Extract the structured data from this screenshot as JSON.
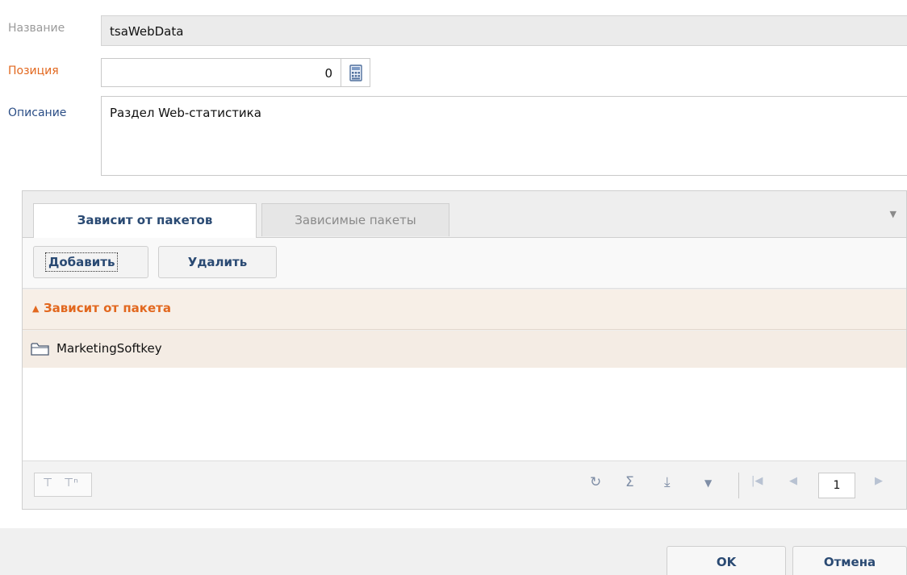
{
  "form": {
    "name_label": "Название",
    "name_value": "tsaWebData",
    "position_label": "Позиция",
    "position_value": "0",
    "description_label": "Описание",
    "description_value": "Раздел Web-статистика"
  },
  "tabs": [
    {
      "label": "Зависит от пакетов",
      "active": true
    },
    {
      "label": "Зависимые пакеты",
      "active": false
    }
  ],
  "toolbar": {
    "add_label": "Добавить",
    "delete_label": "Удалить"
  },
  "grid": {
    "group_title": "Зависит от пакета",
    "rows": [
      {
        "name": "MarketingSoftkey"
      }
    ]
  },
  "paging": {
    "page": "1"
  },
  "footer": {
    "ok_label": "OK",
    "cancel_label": "Отмена"
  },
  "colors": {
    "required_label": "#e2681f",
    "label_blue": "#2b4e86",
    "group_header_bg": "#f7efe7",
    "accent_text": "#2a4a73"
  },
  "icons": {
    "calculator": "calculator-icon",
    "folder": "folder-icon",
    "filter": "filter-icon",
    "refresh": "refresh-icon",
    "sum": "sum-icon",
    "export": "export-icon",
    "menu": "menu-dropdown-icon"
  }
}
